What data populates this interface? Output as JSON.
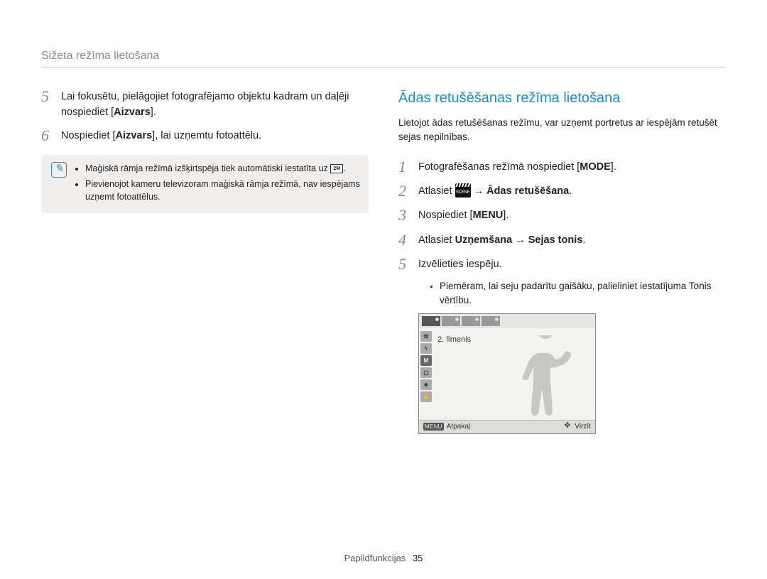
{
  "header": {
    "section_title": "Sižeta režīma lietošana"
  },
  "left": {
    "steps": [
      {
        "num": "5",
        "text_a": "Lai fokusētu, pielāgojiet fotografējamo objektu kadram un daļēji nospiediet [",
        "text_b": "Aizvars",
        "text_c": "]."
      },
      {
        "num": "6",
        "text_a": "Nospiediet [",
        "text_b": "Aizvars",
        "text_c": "], lai uzņemtu fotoattēlu."
      }
    ],
    "note": {
      "bullets": [
        {
          "pre": "Maģiskā rāmja režīmā izšķirtspēja tiek automātiski iestatīta uz ",
          "icon": "2M",
          "post": "."
        },
        {
          "text": "Pievienojot kameru televizoram maģiskā rāmja režīmā, nav iespējams uzņemt fotoattēlus."
        }
      ]
    }
  },
  "right": {
    "heading": "Ādas retušēšanas režīma lietošana",
    "intro": "Lietojot ādas retušēšanas režīmu, var uzņemt portretus ar iespējām retušēt sejas nepilnības.",
    "steps": [
      {
        "num": "1",
        "pre": "Fotografēšanas režīmā nospiediet [",
        "btn": "MODE",
        "post": "]."
      },
      {
        "num": "2",
        "pre": "Atlasiet ",
        "icon": "SCENE",
        "arrow": " → ",
        "bold": "Ādas retušēšana",
        "post2": "."
      },
      {
        "num": "3",
        "pre": "Nospiediet [",
        "btn": "MENU",
        "post": "]."
      },
      {
        "num": "4",
        "pre": "Atlasiet ",
        "bold_a": "Uzņemšana",
        "arrow2": " → ",
        "bold_b": "Sejas tonis",
        "post": "."
      },
      {
        "num": "5",
        "text": "Izvēlieties iespēju."
      }
    ],
    "sub_bullet": "Piemēram, lai seju padarītu gaišāku, palieliniet iestatījuma Tonis vērtību.",
    "screen": {
      "level_label": "2. līmenis",
      "back_label": "Atpakaļ",
      "move_label": "Virzīt",
      "menu_tag": "MENU"
    }
  },
  "footer": {
    "label": "Papildfunkcijas",
    "page": "35"
  }
}
